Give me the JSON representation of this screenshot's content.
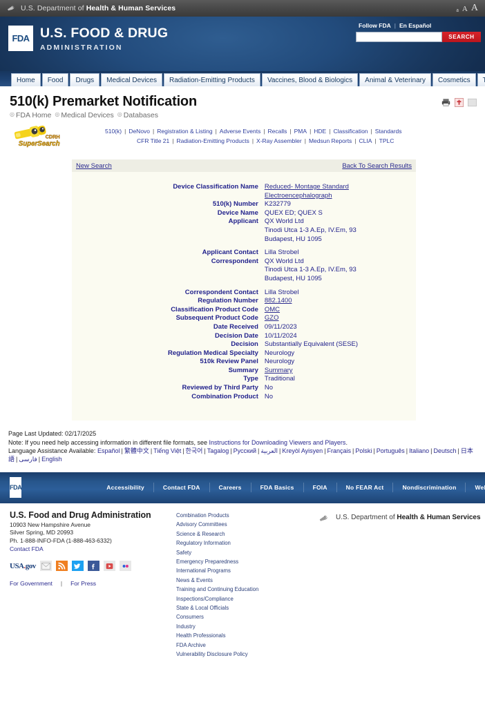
{
  "topbar": {
    "hhs_prefix": "U.S. Department of ",
    "hhs_bold": "Health & Human Services",
    "text_size_small": "a",
    "text_size_medium": "A",
    "text_size_large": "A"
  },
  "header": {
    "logo_mark": "FDA",
    "title_line1": "U.S. FOOD & DRUG",
    "title_line2": "ADMINISTRATION",
    "follow_fda": "Follow FDA",
    "en_espanol": "En Español",
    "separator": "|",
    "search_value": "",
    "search_placeholder": "",
    "search_button": "SEARCH"
  },
  "nav_tabs": [
    "Home",
    "Food",
    "Drugs",
    "Medical Devices",
    "Radiation-Emitting Products",
    "Vaccines, Blood & Biologics",
    "Animal & Veterinary",
    "Cosmetics",
    "Tobacco Products"
  ],
  "page": {
    "title": "510(k) Premarket Notification",
    "breadcrumb": [
      "FDA Home",
      "Medical Devices",
      "Databases"
    ],
    "supersearch_line1": "CDRH",
    "supersearch_line2": "SuperSearch"
  },
  "database_links_row1": [
    "510(k)",
    "DeNovo",
    "Registration & Listing",
    "Adverse Events",
    "Recalls",
    "PMA",
    "HDE",
    "Classification",
    "Standards"
  ],
  "database_links_row2": [
    "CFR Title 21",
    "Radiation-Emitting Products",
    "X-Ray Assembler",
    "Medsun Reports",
    "CLIA",
    "TPLC"
  ],
  "search_bar": {
    "new_search": "New Search",
    "back_to_results": "Back To Search Results"
  },
  "details": [
    {
      "label": "Device Classification Name",
      "value": "Reduced- Montage Standard Electroencephalograph",
      "link": true
    },
    {
      "label": "510(k) Number",
      "value": "K232779",
      "link": false
    },
    {
      "label": "Device Name",
      "value": "QUEX ED; QUEX S",
      "link": false
    },
    {
      "label": "Applicant",
      "value": "QX World Ltd\nTinodi Utca 1-3 A.Ep, IV.Em, 93\nBudapest,  HU 1095",
      "link": false
    },
    {
      "label": "Applicant Contact",
      "value": "Lilla Strobel",
      "link": false,
      "gap_before": true
    },
    {
      "label": "Correspondent",
      "value": "QX World Ltd\nTinodi Utca 1-3 A.Ep, IV.Em, 93\nBudapest,  HU 1095",
      "link": false
    },
    {
      "label": "Correspondent Contact",
      "value": "Lilla Strobel",
      "link": false,
      "gap_before": true
    },
    {
      "label": "Regulation Number",
      "value": "882.1400",
      "link": true
    },
    {
      "label": "Classification Product Code",
      "value": "OMC",
      "link": true
    },
    {
      "label": "Subsequent Product Code",
      "value": "GZO",
      "link": true
    },
    {
      "label": "Date Received",
      "value": "09/11/2023",
      "link": false
    },
    {
      "label": "Decision Date",
      "value": "10/11/2024",
      "link": false
    },
    {
      "label": "Decision",
      "value": "Substantially Equivalent (SESE)",
      "link": false
    },
    {
      "label": "Regulation Medical Specialty",
      "value": "Neurology",
      "link": false
    },
    {
      "label": "510k Review Panel",
      "value": "Neurology",
      "link": false
    },
    {
      "label": "Summary",
      "value": "Summary",
      "link": true
    },
    {
      "label": "Type",
      "value": "Traditional",
      "link": false
    },
    {
      "label": "Reviewed by Third Party",
      "value": "No",
      "link": false
    },
    {
      "label": "Combination Product",
      "value": "No",
      "link": false
    }
  ],
  "notes": {
    "page_updated": "Page Last Updated: 02/17/2025",
    "note_prefix": "Note: If you need help accessing information in different file formats, see ",
    "note_link": "Instructions for Downloading Viewers and Players",
    "note_suffix": ".",
    "language_label": "Language Assistance Available: ",
    "languages": [
      "Español",
      "繁體中文",
      "Tiếng Việt",
      "한국어",
      "Tagalog",
      "Русский",
      "العربية",
      "Kreyòl Ayisyen",
      "Français",
      "Polski",
      "Português",
      "Italiano",
      "Deutsch",
      "日本語",
      "فارسی",
      "English"
    ]
  },
  "footer_nav": [
    "Accessibility",
    "Contact FDA",
    "Careers",
    "FDA Basics",
    "FOIA",
    "No FEAR Act",
    "Nondiscrimination",
    "Website Policies / Privacy"
  ],
  "footer": {
    "fda_mark": "FDA",
    "agency": "U.S. Food and Drug Administration",
    "address_line1": "10903 New Hampshire Avenue",
    "address_line2": "Silver Spring, MD 20993",
    "phone": "Ph. 1-888-INFO-FDA (1-888-463-6332)",
    "contact_link": "Contact FDA",
    "usagov": "USA.gov",
    "for_government": "For Government",
    "for_press": "For Press",
    "separator": "|",
    "links": [
      "Combination Products",
      "Advisory Committees",
      "Science & Research",
      "Regulatory Information",
      "Safety",
      "Emergency Preparedness",
      "International Programs",
      "News & Events",
      "Training and Continuing Education",
      "Inspections/Compliance",
      "State & Local Officials",
      "Consumers",
      "Industry",
      "Health Professionals",
      "FDA Archive",
      "Vulnerability Disclosure Policy"
    ],
    "hhs_prefix": "U.S. Department of ",
    "hhs_bold": "Health & Human Services"
  },
  "colors": {
    "fda_blue": "#1d4574",
    "search_red": "#c8191f",
    "link_blue": "#2a2a8f",
    "panel_bg": "#fbfbf1"
  }
}
